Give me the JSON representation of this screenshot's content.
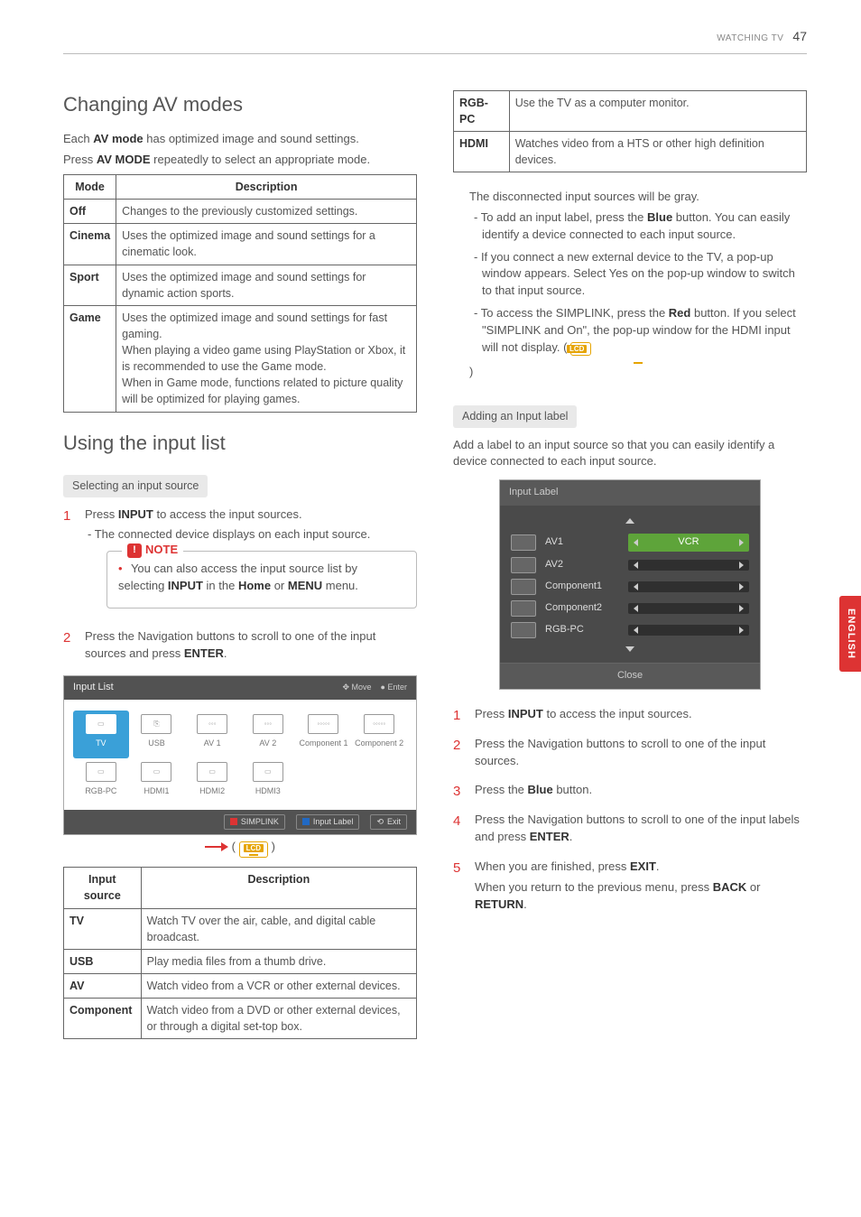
{
  "header": {
    "section": "WATCHING TV",
    "page": "47"
  },
  "side_tab": "ENGLISH",
  "left": {
    "h_av": "Changing AV modes",
    "av_intro1a": "Each ",
    "av_intro1b": "AV mode",
    "av_intro1c": " has optimized image and sound settings.",
    "av_intro2a": "Press ",
    "av_intro2b": "AV MODE",
    "av_intro2c": " repeatedly to select an appropriate mode.",
    "av_table": {
      "h1": "Mode",
      "h2": "Description",
      "rows": [
        {
          "m": "Off",
          "d": "Changes to the previously customized settings."
        },
        {
          "m": "Cinema",
          "d": "Uses the optimized image and sound settings for a cinematic look."
        },
        {
          "m": "Sport",
          "d": "Uses the optimized image and sound settings for dynamic action sports."
        },
        {
          "m": "Game",
          "d": "Uses the optimized image and sound settings for fast gaming.\nWhen playing a video game using PlayStation or Xbox, it is recommended to use the Game mode.\nWhen in Game mode, functions related to picture quality will be optimized for playing games."
        }
      ]
    },
    "h_input": "Using the input list",
    "pill_select": "Selecting an input source",
    "step1a": "Press ",
    "step1b": "INPUT",
    "step1c": " to access the input sources.",
    "step1_sub": "- The connected device displays on each input source.",
    "note_title": "NOTE",
    "note_body_a": "You can also access the input source list by selecting ",
    "note_body_b": "INPUT",
    "note_body_c": " in the ",
    "note_body_d": "Home",
    "note_body_e": " or ",
    "note_body_f": "MENU",
    "note_body_g": " menu.",
    "step2a": "Press the Navigation buttons to scroll to one of the input sources and press ",
    "step2b": "ENTER",
    "step2c": ".",
    "input_list_panel": {
      "title": "Input List",
      "move": "Move",
      "enter": "Enter",
      "items": [
        "TV",
        "USB",
        "AV 1",
        "AV 2",
        "Component 1",
        "Component 2",
        "RGB-PC",
        "HDMI1",
        "HDMI2",
        "HDMI3"
      ],
      "footer_simplink": "SIMPLINK",
      "footer_label": "Input Label",
      "footer_exit": "Exit"
    },
    "lcd": "LCD",
    "src_table": {
      "h1": "Input source",
      "h2": "Description",
      "rows": [
        {
          "s": "TV",
          "d": "Watch TV over the air, cable, and digital cable broadcast."
        },
        {
          "s": "USB",
          "d": "Play media files from a thumb drive."
        },
        {
          "s": "AV",
          "d": "Watch video from a VCR or other external devices."
        },
        {
          "s": "Component",
          "d": "Watch video from a DVD or other external devices, or through a digital set-top box."
        }
      ]
    }
  },
  "right": {
    "top_table": {
      "rows": [
        {
          "s": "RGB-PC",
          "d": "Use the TV as a computer monitor."
        },
        {
          "s": "HDMI",
          "d": "Watches video from a HTS or other high definition devices."
        }
      ]
    },
    "note1": "The disconnected input sources will be gray.",
    "note2a": "- To add an input label, press the ",
    "note2b": "Blue",
    "note2c": " button. You can easily identify a device connected to each input source.",
    "note3": "- If you connect a new external device to the TV, a pop-up window appears. Select Yes on the pop-up window to switch to that input source.",
    "note4a": "- To access the SIMPLINK, press the ",
    "note4b": "Red",
    "note4c": " button. If you select \"SIMPLINK and On\", the pop-up window for the HDMI input will not display. ( ",
    "note4d": " )",
    "pill_add": "Adding an Input label",
    "add_intro": "Add a label to an input source so that you can easily identify a device connected to each input source.",
    "dialog": {
      "title": "Input Label",
      "rows": [
        {
          "name": "AV1",
          "val": "VCR",
          "active": true
        },
        {
          "name": "AV2",
          "val": ""
        },
        {
          "name": "Component1",
          "val": ""
        },
        {
          "name": "Component2",
          "val": ""
        },
        {
          "name": "RGB-PC",
          "val": ""
        }
      ],
      "close": "Close"
    },
    "s1a": "Press ",
    "s1b": "INPUT",
    "s1c": " to access the input sources.",
    "s2": "Press the Navigation buttons to scroll to one of the input sources.",
    "s3a": "Press the ",
    "s3b": "Blue",
    "s3c": " button.",
    "s4a": "Press the Navigation buttons to scroll to one of the input labels and press ",
    "s4b": "ENTER",
    "s4c": ".",
    "s5a": "When you are finished, press ",
    "s5b": "EXIT",
    "s5c": ".",
    "s5d": "When you return to the previous menu, press ",
    "s5e": "BACK",
    "s5f": " or ",
    "s5g": "RETURN",
    "s5h": "."
  }
}
